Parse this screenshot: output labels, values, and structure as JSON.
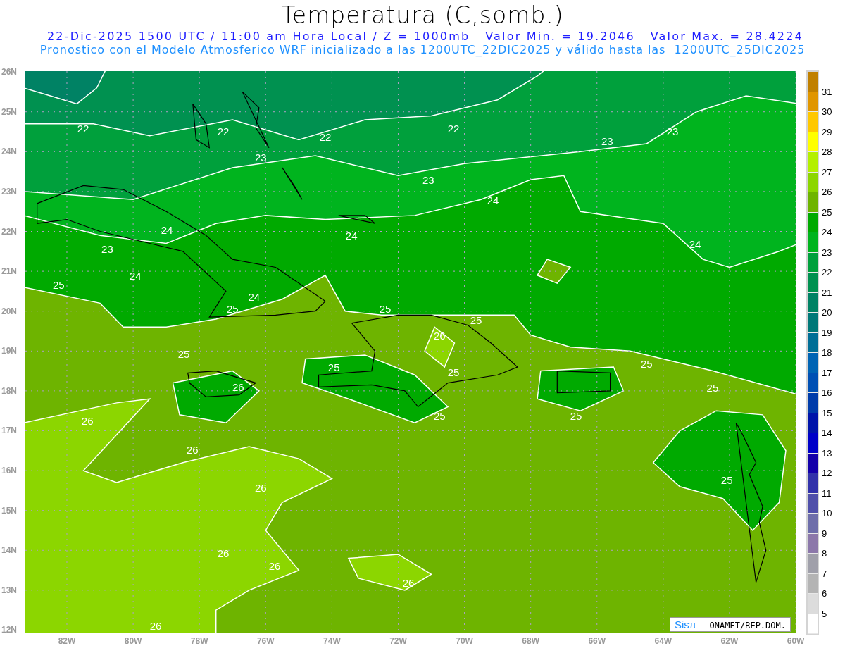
{
  "title": "Temperatura (C,somb.)",
  "subtitle": "22-Dic-2025 1500 UTC / 11:00 am Hora Local / Z = 1000mb   Valor Min. = 19.2046   Valor Max. = 28.4224",
  "description": "Pronostico con el Modelo Atmosferico WRF inicializado a las 1200UTC_22DIC2025 y válido hasta las  1200UTC_25DIC2025",
  "map": {
    "lat_ticks": [
      "26N",
      "25N",
      "24N",
      "23N",
      "22N",
      "21N",
      "20N",
      "19N",
      "18N",
      "17N",
      "16N",
      "15N",
      "14N",
      "13N",
      "12N"
    ],
    "lon_ticks": [
      "82W",
      "80W",
      "78W",
      "76W",
      "74W",
      "72W",
      "70W",
      "68W",
      "66W",
      "64W",
      "62W",
      "60W"
    ],
    "contour_labels": [
      "22",
      "22",
      "22",
      "22",
      "23",
      "23",
      "23",
      "23",
      "24",
      "24",
      "24",
      "24",
      "23",
      "24",
      "25",
      "25",
      "24",
      "25",
      "25",
      "26",
      "25",
      "25",
      "25",
      "25",
      "25",
      "26",
      "25",
      "25",
      "26",
      "26",
      "26",
      "25",
      "26",
      "26",
      "26",
      "26"
    ],
    "logo": {
      "brand": "Sisπ",
      "org": "– ONAMET/REP.DOM."
    }
  },
  "legend": {
    "levels": [
      {
        "color": "#c08000",
        "label": "31"
      },
      {
        "color": "#e09600",
        "label": "30"
      },
      {
        "color": "#ffc800",
        "label": "29"
      },
      {
        "color": "#ffff00",
        "label": "28"
      },
      {
        "color": "#b4f000",
        "label": "27"
      },
      {
        "color": "#8cd600",
        "label": "26"
      },
      {
        "color": "#6eb400",
        "label": "25"
      },
      {
        "color": "#00aa00",
        "label": "24"
      },
      {
        "color": "#00b41e",
        "label": "23"
      },
      {
        "color": "#00a03c",
        "label": "22"
      },
      {
        "color": "#009150",
        "label": "21"
      },
      {
        "color": "#008264",
        "label": "20"
      },
      {
        "color": "#007878",
        "label": "19"
      },
      {
        "color": "#006e96",
        "label": "18"
      },
      {
        "color": "#0064b4",
        "label": "17"
      },
      {
        "color": "#0050b4",
        "label": "16"
      },
      {
        "color": "#003caa",
        "label": "15"
      },
      {
        "color": "#0014aa",
        "label": "14"
      },
      {
        "color": "#0000c8",
        "label": "13"
      },
      {
        "color": "#1400aa",
        "label": "12"
      },
      {
        "color": "#3232aa",
        "label": "11"
      },
      {
        "color": "#5050aa",
        "label": "10"
      },
      {
        "color": "#6e6eaa",
        "label": "9"
      },
      {
        "color": "#8c78aa",
        "label": "8"
      },
      {
        "color": "#a0a0aa",
        "label": "7"
      },
      {
        "color": "#b4b4b4",
        "label": "6"
      },
      {
        "color": "#dcdcdc",
        "label": "5"
      },
      {
        "color": "#ffffff"
      }
    ]
  }
}
